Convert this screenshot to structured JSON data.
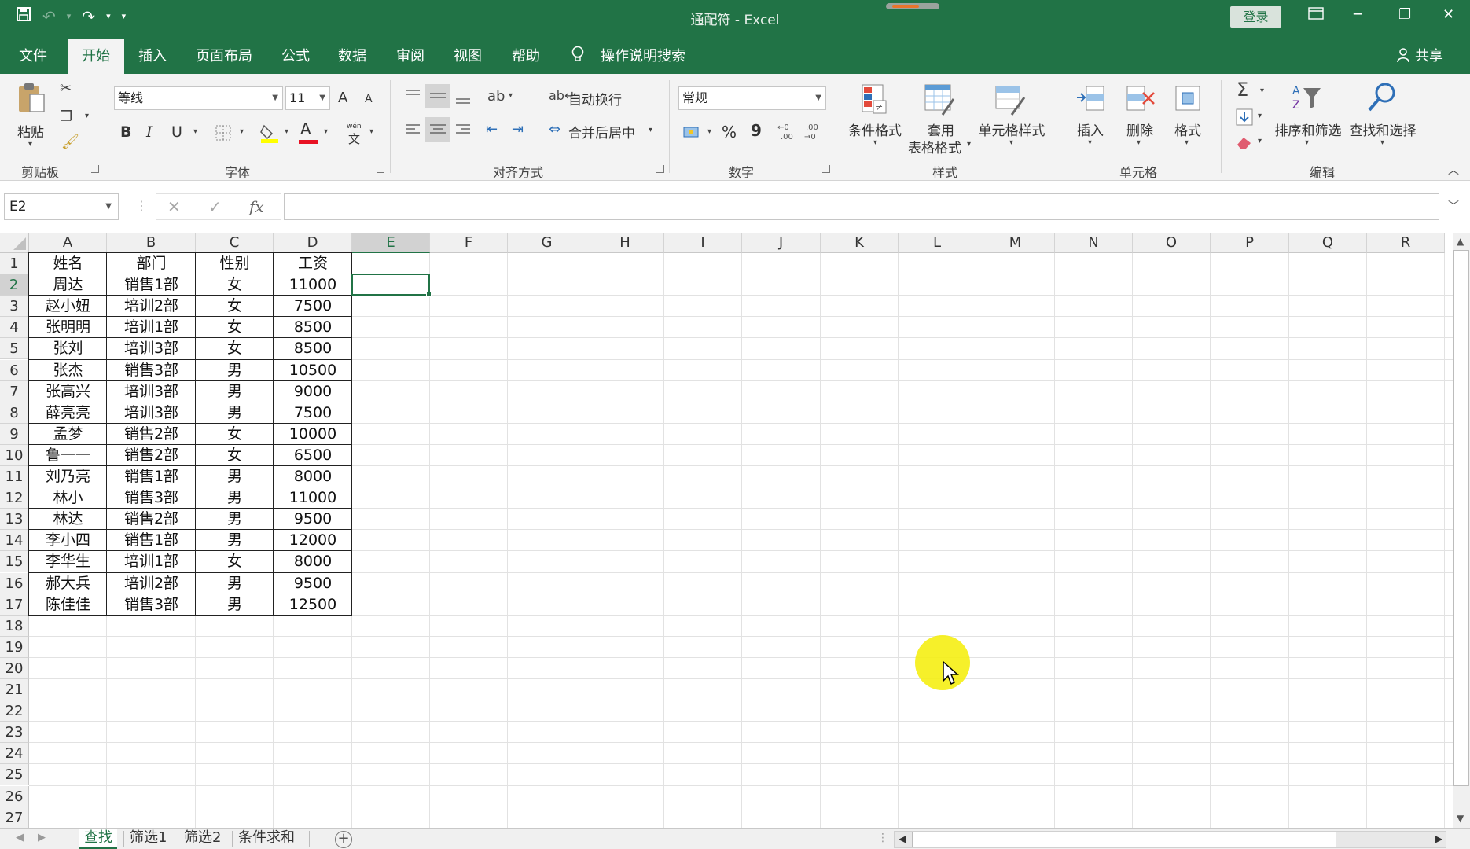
{
  "app": {
    "title": "通配符  -  Excel",
    "login_label": "登录",
    "share_label": "共享"
  },
  "menu": {
    "tabs": [
      "文件",
      "开始",
      "插入",
      "页面布局",
      "公式",
      "数据",
      "审阅",
      "视图",
      "帮助"
    ],
    "active_tab": "开始",
    "search_label": "操作说明搜索"
  },
  "ribbon": {
    "clipboard": {
      "group_label": "剪贴板",
      "paste_label": "粘贴"
    },
    "font": {
      "group_label": "字体",
      "font_name": "等线",
      "font_size": "11",
      "bold": "B",
      "italic": "I",
      "underline": "U",
      "grow": "A",
      "shrink": "A",
      "color_letter": "A",
      "phonetic": "wén",
      "phonetic_char": "文"
    },
    "alignment": {
      "group_label": "对齐方式",
      "wrap_label": "自动换行",
      "merge_label": "合并后居中"
    },
    "number": {
      "group_label": "数字",
      "format": "常规",
      "percent": "%",
      "comma": "9"
    },
    "styles": {
      "group_label": "样式",
      "conditional_label": "条件格式",
      "table_label_line1": "套用",
      "table_label_line2": "表格格式",
      "cell_styles_label": "单元格样式"
    },
    "cells": {
      "group_label": "单元格",
      "insert_label": "插入",
      "delete_label": "删除",
      "format_label": "格式"
    },
    "editing": {
      "group_label": "编辑",
      "sort_label": "排序和筛选",
      "find_label": "查找和选择"
    }
  },
  "formula_bar": {
    "name_box": "E2",
    "fx_label": "fx",
    "value": ""
  },
  "sheet": {
    "columns": [
      "A",
      "B",
      "C",
      "D",
      "E",
      "F",
      "G",
      "H",
      "I",
      "J",
      "K",
      "L",
      "M",
      "N",
      "O",
      "P",
      "Q",
      "R"
    ],
    "rows": [
      "1",
      "2",
      "3",
      "4",
      "5",
      "6",
      "7",
      "8",
      "9",
      "10",
      "11",
      "12",
      "13",
      "14",
      "15",
      "16",
      "17",
      "18",
      "19",
      "20",
      "21",
      "22",
      "23",
      "24",
      "25",
      "26",
      "27"
    ],
    "selected_cell": "E2",
    "headers": [
      "姓名",
      "部门",
      "性别",
      "工资"
    ],
    "data": [
      [
        "周达",
        "销售1部",
        "女",
        "11000"
      ],
      [
        "赵小妞",
        "培训2部",
        "女",
        "7500"
      ],
      [
        "张明明",
        "培训1部",
        "女",
        "8500"
      ],
      [
        "张刘",
        "培训3部",
        "女",
        "8500"
      ],
      [
        "张杰",
        "销售3部",
        "男",
        "10500"
      ],
      [
        "张高兴",
        "培训3部",
        "男",
        "9000"
      ],
      [
        "薛亮亮",
        "培训3部",
        "男",
        "7500"
      ],
      [
        "孟梦",
        "销售2部",
        "女",
        "10000"
      ],
      [
        "鲁一一",
        "销售2部",
        "女",
        "6500"
      ],
      [
        "刘乃亮",
        "销售1部",
        "男",
        "8000"
      ],
      [
        "林小",
        "销售3部",
        "男",
        "11000"
      ],
      [
        "林达",
        "销售2部",
        "男",
        "9500"
      ],
      [
        "李小四",
        "销售1部",
        "男",
        "12000"
      ],
      [
        "李华生",
        "培训1部",
        "女",
        "8000"
      ],
      [
        "郝大兵",
        "培训2部",
        "男",
        "9500"
      ],
      [
        "陈佳佳",
        "销售3部",
        "男",
        "12500"
      ]
    ]
  },
  "sheet_tabs": {
    "tabs": [
      "查找",
      "筛选1",
      "筛选2",
      "条件求和"
    ],
    "active": "查找",
    "add_label": "+"
  },
  "colors": {
    "accent": "#217346",
    "cursor_highlight": "#f5ee13"
  }
}
